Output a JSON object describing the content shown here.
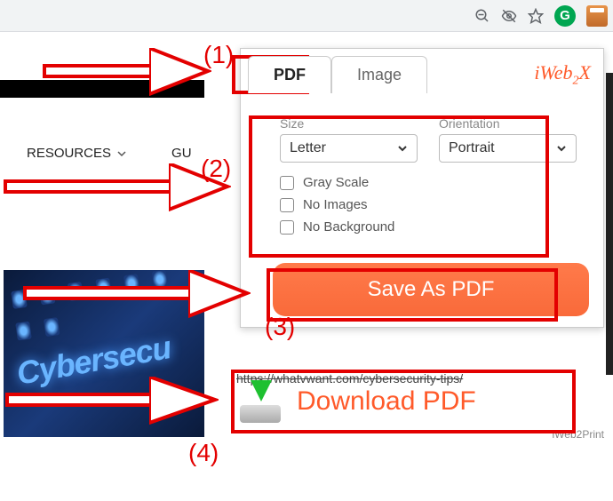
{
  "nav": {
    "resources": "RESOURCES",
    "guides_partial": "GU"
  },
  "popup": {
    "tabs": {
      "pdf": "PDF",
      "image": "Image"
    },
    "brand_parts": [
      "iWeb",
      "2",
      "X"
    ],
    "size_label": "Size",
    "orientation_label": "Orientation",
    "size_value": "Letter",
    "orientation_value": "Portrait",
    "check_gray": "Gray Scale",
    "check_noimg": "No Images",
    "check_nobg": "No Background",
    "save_btn": "Save As PDF"
  },
  "url_text": "https://whatvwant.com/cybersecurity-tips/",
  "download_text": "Download PDF",
  "footer_text": "iWeb2Print",
  "cyber_text": "Cybersecu",
  "annotations": {
    "n1": "(1)",
    "n2": "(2)",
    "n3": "(3)",
    "n4": "(4)"
  }
}
